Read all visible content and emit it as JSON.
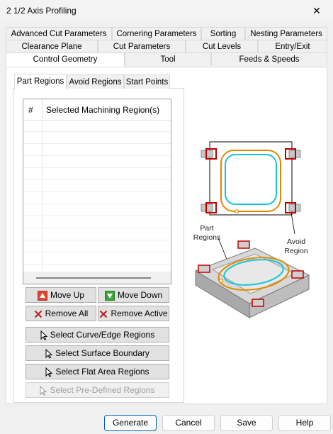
{
  "window": {
    "title": "2 1/2 Axis Profiling",
    "close": "✕"
  },
  "tabs": {
    "row1": [
      "Advanced Cut Parameters",
      "Cornering Parameters",
      "Sorting",
      "Nesting Parameters"
    ],
    "row2": [
      "Clearance Plane",
      "Cut Parameters",
      "Cut Levels",
      "Entry/Exit"
    ],
    "row3": [
      "Control Geometry",
      "Tool",
      "Feeds & Speeds"
    ],
    "selected": "Control Geometry"
  },
  "subtabs": [
    "Part Regions",
    "Avoid Regions",
    "Start Points"
  ],
  "list": {
    "col_num": "#",
    "col_region": "Selected Machining Region(s)"
  },
  "buttons": {
    "move_up": "Move Up",
    "move_down": "Move Down",
    "remove_all": "Remove All",
    "remove_active": "Remove Active",
    "select_curve": "Select Curve/Edge Regions",
    "select_surface": "Select Surface Boundary",
    "select_flat": "Select Flat Area Regions",
    "select_predefined": "Select Pre-Defined Regions"
  },
  "diagram": {
    "part_label_1": "Part",
    "part_label_2": "Regions",
    "avoid_label_1": "Avoid",
    "avoid_label_2": "Region"
  },
  "footer": {
    "generate": "Generate",
    "cancel": "Cancel",
    "save": "Save",
    "help": "Help"
  },
  "colors": {
    "red": "#c00000",
    "orange": "#e08a00",
    "cyan": "#19c3d9",
    "arrow_up": "#e0462e",
    "arrow_down": "#3aa63a"
  }
}
